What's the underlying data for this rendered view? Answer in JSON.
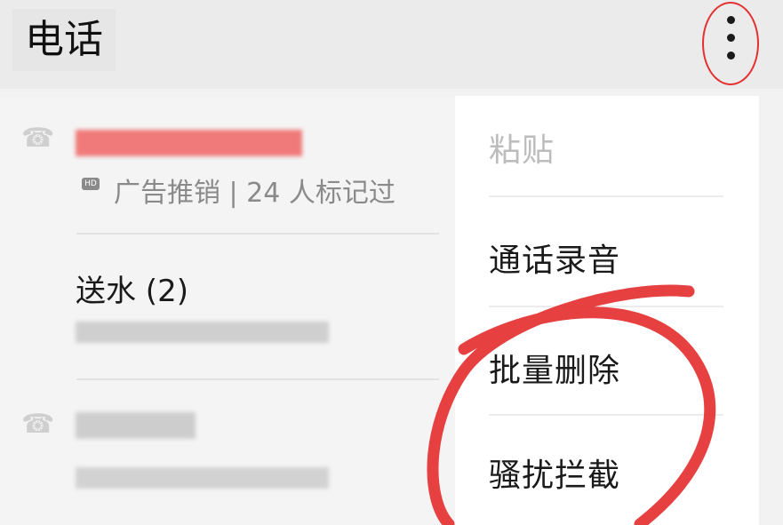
{
  "header": {
    "title": "电话"
  },
  "calls": [
    {
      "name": "",
      "meta": "广告推销 | 24 人标记过"
    },
    {
      "name": "送水 (2)",
      "meta": ""
    },
    {
      "name": "",
      "meta": ""
    }
  ],
  "menu": {
    "items": [
      {
        "label": "粘贴",
        "enabled": false
      },
      {
        "label": "通话录音",
        "enabled": true
      },
      {
        "label": "批量删除",
        "enabled": true
      },
      {
        "label": "骚扰拦截",
        "enabled": true
      }
    ]
  },
  "colors": {
    "annotation": "#e53030",
    "spam_number": "#f07a7a",
    "disabled_text": "#bcbcbc",
    "secondary_text": "#8a8a8a"
  },
  "icons": {
    "more": "more-vertical-icon",
    "call": "phone-icon",
    "hd": "hd-badge-icon"
  }
}
